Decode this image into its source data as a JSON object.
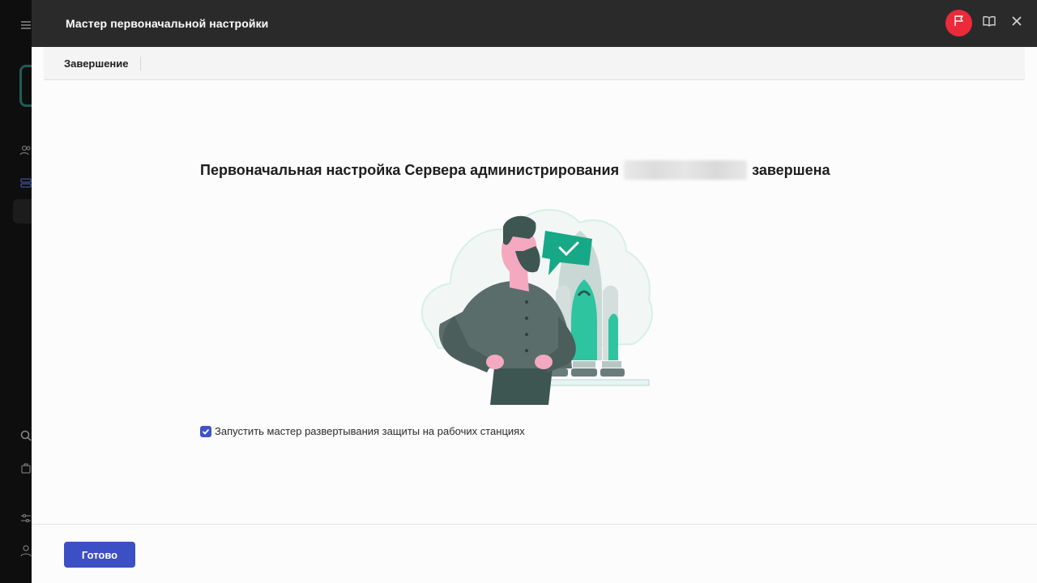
{
  "dialog": {
    "title": "Мастер первоначальной настройки",
    "step_label": "Завершение"
  },
  "content": {
    "heading_before": "Первоначальная настройка Сервера администрирования",
    "heading_after": "завершена",
    "checkbox_label": "Запустить мастер развертывания защиты на рабочих станциях",
    "checkbox_checked": true
  },
  "footer": {
    "done_label": "Готово"
  },
  "icons": {
    "titlebar": [
      "flag-icon",
      "book-icon",
      "close-icon"
    ],
    "background_sidebar": [
      "menu-icon",
      "users-icon",
      "servers-icon",
      "search-icon",
      "bag-icon",
      "sliders-icon",
      "user-icon"
    ]
  },
  "colors": {
    "accent": "#3d4fc4",
    "flag_button": "#ec2a3a",
    "titlebar": "#2a2a2b",
    "illustration_green": "#2ec4a0"
  }
}
